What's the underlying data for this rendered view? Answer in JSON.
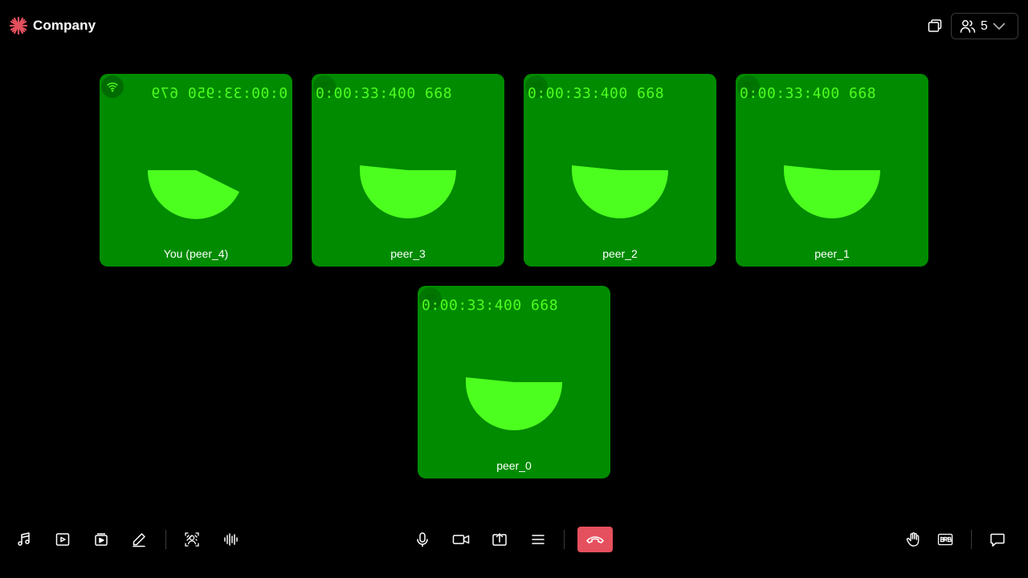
{
  "header": {
    "brand_name": "Company",
    "brand_color": "#e5505e",
    "logo_icon": "asterisk-burst-icon",
    "layout_icon": "layout-stack-icon",
    "participants_icon": "people-icon",
    "participants_count": "5",
    "dropdown_icon": "chevron-down-icon"
  },
  "tiles": [
    {
      "peer_name": "You (peer_4)",
      "timecode": "0:00:33:950 679",
      "timecode_mirrored": true,
      "network_icon": "wifi-icon"
    },
    {
      "peer_name": "peer_3",
      "timecode": "0:00:33:400 668",
      "timecode_mirrored": false,
      "network_icon": "wifi-icon"
    },
    {
      "peer_name": "peer_2",
      "timecode": "0:00:33:400 668",
      "timecode_mirrored": false,
      "network_icon": "wifi-icon"
    },
    {
      "peer_name": "peer_1",
      "timecode": "0:00:33:400 668",
      "timecode_mirrored": false,
      "network_icon": "wifi-icon"
    },
    {
      "peer_name": "peer_0",
      "timecode": "0:00:33:400 668",
      "timecode_mirrored": false,
      "network_icon": "wifi-icon"
    }
  ],
  "colors": {
    "tile_background": "#008b00",
    "pattern": "#4cff1f",
    "leave_button": "#e5505e"
  },
  "toolbar": {
    "left": [
      "music-note-icon",
      "video-play-icon",
      "media-gallery-icon",
      "pencil-icon",
      "virtual-background-icon",
      "audio-waveform-icon"
    ],
    "center": [
      "microphone-icon",
      "camera-icon",
      "screen-share-icon",
      "menu-icon",
      "leave-call-icon"
    ],
    "right": [
      "raise-hand-icon",
      "brb-icon",
      "chat-icon"
    ]
  }
}
